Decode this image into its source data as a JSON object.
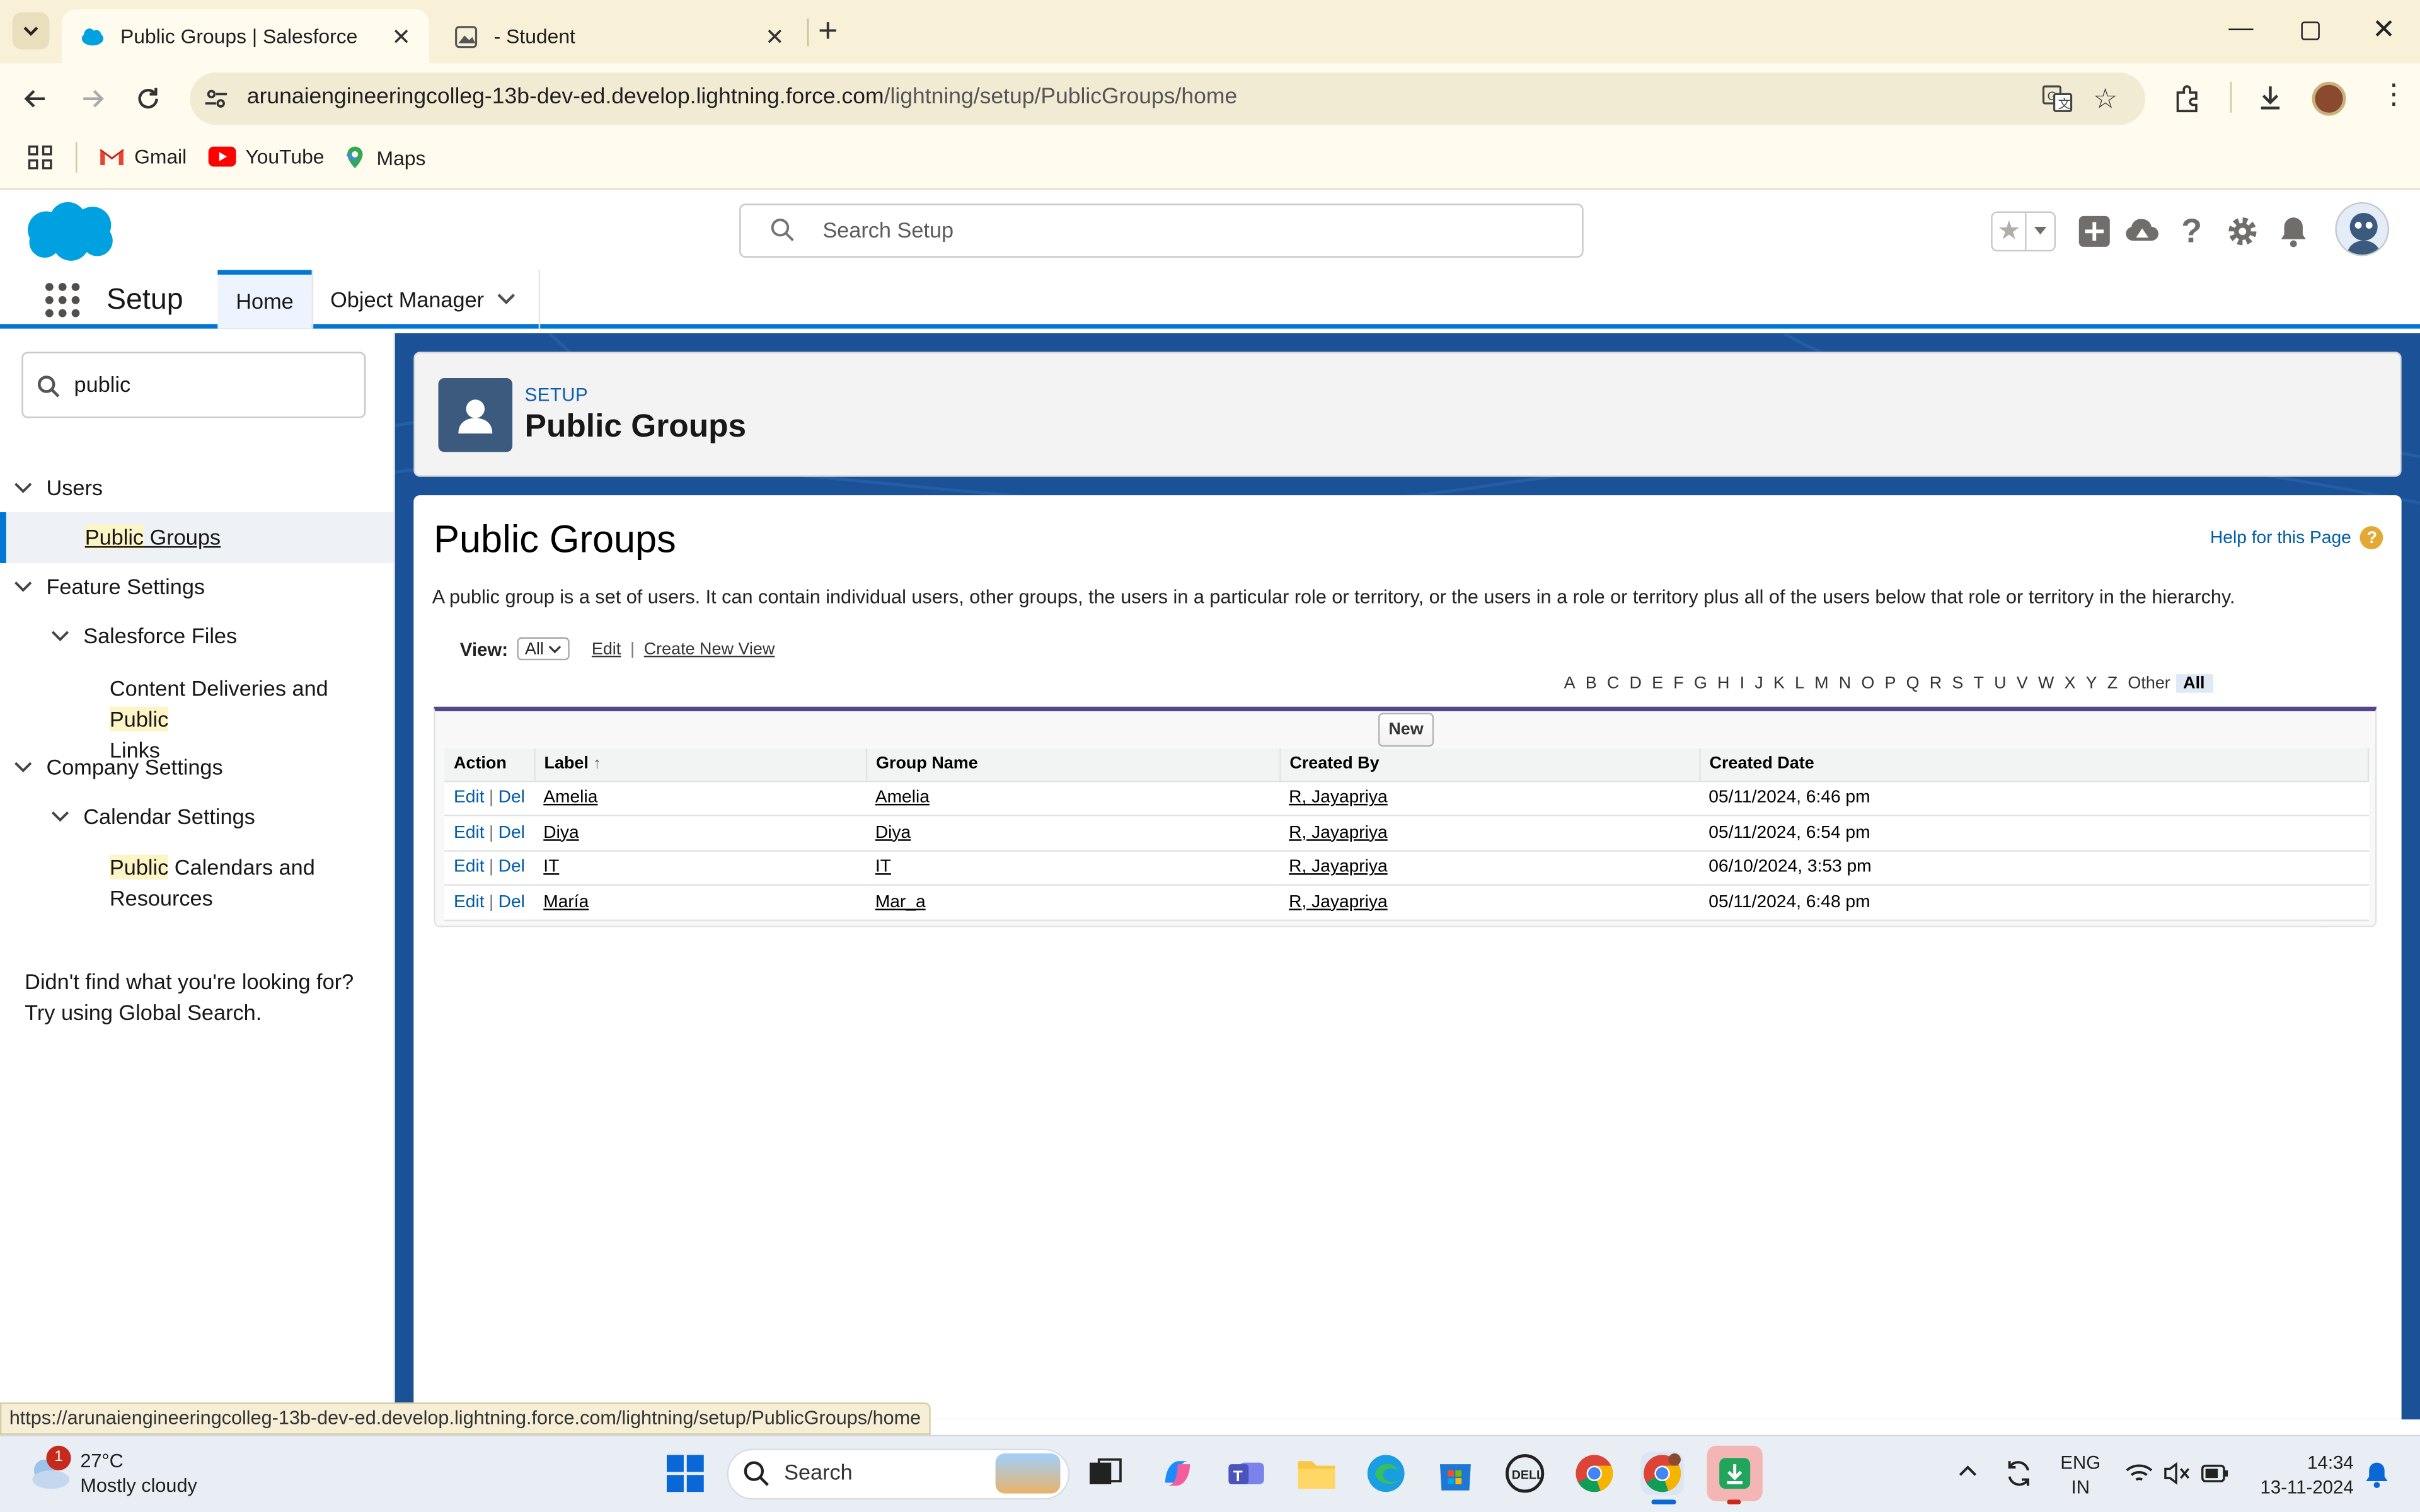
{
  "browser": {
    "tabs": [
      {
        "title": "Public Groups | Salesforce",
        "active": true
      },
      {
        "title": "- Student",
        "active": false
      }
    ],
    "url_host": "arunaiengineeringcolleg-13b-dev-ed.develop.lightning.force.com",
    "url_path": "/lightning/setup/PublicGroups/home",
    "bookmarks": [
      "Gmail",
      "YouTube",
      "Maps"
    ],
    "status_url": "https://arunaiengineeringcolleg-13b-dev-ed.develop.lightning.force.com/lightning/setup/PublicGroups/home"
  },
  "sf": {
    "search_placeholder": "Search Setup",
    "app_name": "Setup",
    "nav_tabs": [
      "Home",
      "Object Manager"
    ]
  },
  "sidebar": {
    "quick_find_value": "public",
    "tree": {
      "users": "Users",
      "public_groups_hl": "Public",
      "public_groups_rest": " Groups",
      "feature_settings": "Feature Settings",
      "salesforce_files": "Salesforce Files",
      "content_del_pre": "Content Deliveries and ",
      "content_del_hl": "Public",
      "content_del_post": "Links",
      "company_settings": "Company Settings",
      "calendar_settings": "Calendar Settings",
      "public_cal_hl": "Public",
      "public_cal_rest": " Calendars and",
      "public_cal_post": "Resources"
    },
    "hint_line1": "Didn't find what you're looking for?",
    "hint_line2": "Try using Global Search."
  },
  "page": {
    "breadcrumb": "SETUP",
    "header_title": "Public Groups",
    "content_title": "Public Groups",
    "help_link": "Help for this Page",
    "description": "A public group is a set of users. It can contain individual users, other groups, the users in a particular role or territory, or the users in a role or territory plus all of the users below that role or territory in the hierarchy.",
    "view_label": "View:",
    "view_selected": "All",
    "edit_link": "Edit",
    "create_view_link": "Create New View",
    "alphabet": [
      "A",
      "B",
      "C",
      "D",
      "E",
      "F",
      "G",
      "H",
      "I",
      "J",
      "K",
      "L",
      "M",
      "N",
      "O",
      "P",
      "Q",
      "R",
      "S",
      "T",
      "U",
      "V",
      "W",
      "X",
      "Y",
      "Z",
      "Other",
      "All"
    ],
    "new_button": "New",
    "columns": [
      "Action",
      "Label",
      "Group Name",
      "Created By",
      "Created Date"
    ],
    "sort_indicator": "↑",
    "rows": [
      {
        "label": "Amelia",
        "group_name": "Amelia",
        "created_by": "R, Jayapriya",
        "created_date": "05/11/2024, 6:46 pm"
      },
      {
        "label": "Diya",
        "group_name": "Diya",
        "created_by": "R, Jayapriya",
        "created_date": "05/11/2024, 6:54 pm"
      },
      {
        "label": "IT",
        "group_name": "IT",
        "created_by": "R, Jayapriya",
        "created_date": "06/10/2024, 3:53 pm"
      },
      {
        "label": "María",
        "group_name": "Mar_a",
        "created_by": "R, Jayapriya",
        "created_date": "05/11/2024, 6:48 pm"
      }
    ],
    "row_edit": "Edit",
    "row_del": "Del",
    "row_sep": "|"
  },
  "taskbar": {
    "weather_badge": "1",
    "weather_temp": "27°C",
    "weather_desc": "Mostly cloudy",
    "search_label": "Search",
    "lang_line1": "ENG",
    "lang_line2": "IN",
    "time": "14:34",
    "date": "13-11-2024"
  },
  "colors": {
    "brand_blue": "#0176d3",
    "page_bg_blue": "#1b5297",
    "table_accent": "#56458c",
    "link": "#015ba7"
  },
  "icons": [
    "salesforce-logo",
    "search-icon",
    "favorites-star-icon",
    "add-icon",
    "trailhead-icon",
    "help-icon",
    "gear-icon",
    "bell-icon",
    "avatar",
    "app-launcher-icon",
    "chevron-down-icon",
    "group-icon"
  ]
}
